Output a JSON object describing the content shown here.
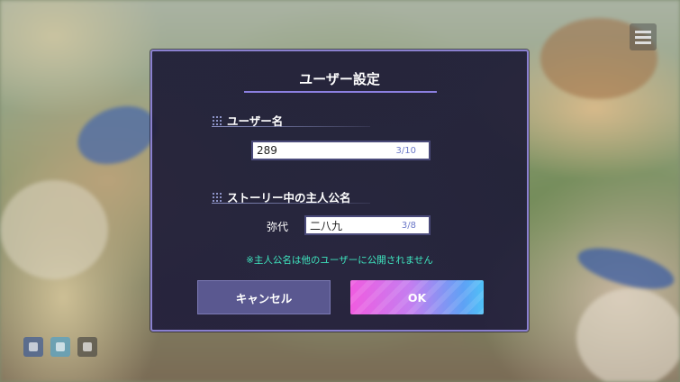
{
  "dialog": {
    "title": "ユーザー設定",
    "username_section": {
      "label": "ユーザー名",
      "value": "289",
      "counter": "3/10"
    },
    "protagonist_section": {
      "label": "ストーリー中の主人公名",
      "surname": "弥代",
      "value": "二八九",
      "counter": "3/8"
    },
    "note": "※主人公名は他のユーザーに公開されません",
    "cancel_label": "キャンセル",
    "ok_label": "OK"
  },
  "colors": {
    "accent_border": "#8a80cf",
    "note_text": "#3fe7c0",
    "counter_text": "#6b78c8"
  },
  "icons": [
    "menu-icon",
    "grid-icon",
    "bottom-icon-1",
    "bottom-icon-2",
    "bottom-icon-3"
  ]
}
